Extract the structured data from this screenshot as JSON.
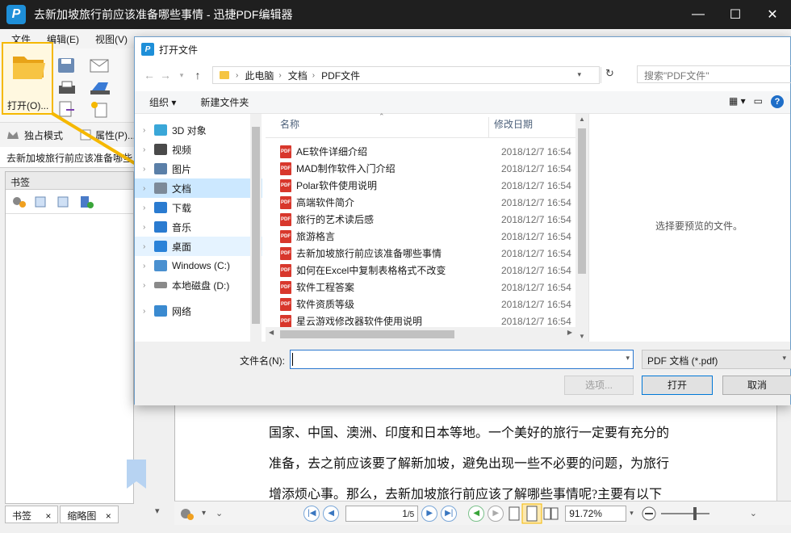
{
  "app": {
    "logo_letter": "P",
    "title": "去新加坡旅行前应该准备哪些事情 - 迅捷PDF编辑器",
    "window_buttons": [
      "—",
      "☐",
      "✕"
    ]
  },
  "menu": [
    "文件",
    "编辑(E)",
    "视图(V)"
  ],
  "ribbon": {
    "open_label": "打开(O)...",
    "exclusive_mode": "独占模式",
    "properties": "属性(P)..."
  },
  "doc_tab": "去新加坡旅行前应该准备哪些",
  "left_panel": {
    "title": "书签",
    "bottom_tabs": [
      {
        "label": "书签",
        "close": "×"
      },
      {
        "label": "缩略图",
        "close": "×"
      }
    ]
  },
  "document": {
    "lines": [
      "国家、中国、澳洲、印度和日本等地。一个美好的旅行一定要有充分的",
      "准备，去之前应该要了解新加坡，避免出现一些不必要的问题，为旅行",
      "增添烦心事。那么，去新加坡旅行前应该了解哪些事情呢?主要有以下"
    ]
  },
  "statusbar": {
    "page": "1",
    "page_total": "/5",
    "zoom": "91.72%"
  },
  "dialog": {
    "title": "打开文件",
    "logo_letter": "P",
    "breadcrumbs": [
      "此电脑",
      "文档",
      "PDF文件"
    ],
    "search_placeholder": "搜索\"PDF文件\"",
    "organize": "组织 ▾",
    "new_folder": "新建文件夹",
    "nav_items": [
      {
        "label": "3D 对象",
        "icon": "cube-3d-icon",
        "color": "#3aa7d8"
      },
      {
        "label": "视频",
        "icon": "video-icon",
        "color": "#4a4a4a"
      },
      {
        "label": "图片",
        "icon": "picture-icon",
        "color": "#5a7fa8"
      },
      {
        "label": "文档",
        "icon": "document-icon",
        "color": "#7d8a99"
      },
      {
        "label": "下载",
        "icon": "download-arrow-icon",
        "color": "#2a7bd0"
      },
      {
        "label": "音乐",
        "icon": "music-note-icon",
        "color": "#2a7bd0"
      },
      {
        "label": "桌面",
        "icon": "desktop-icon",
        "color": "#2a82d8"
      },
      {
        "label": "Windows (C:)",
        "icon": "windows-drive-icon",
        "color": "#4a90d0"
      },
      {
        "label": "本地磁盘 (D:)",
        "icon": "disk-drive-icon",
        "color": "#8a8a8a"
      },
      {
        "label": "网络",
        "icon": "network-icon",
        "color": "#3a8ad0"
      }
    ],
    "columns": {
      "name": "名称",
      "date": "修改日期"
    },
    "files": [
      {
        "name": "AE软件详细介绍",
        "date": "2018/12/7 16:54"
      },
      {
        "name": "MAD制作软件入门介绍",
        "date": "2018/12/7 16:54"
      },
      {
        "name": "Polar软件使用说明",
        "date": "2018/12/7 16:54"
      },
      {
        "name": "高端软件简介",
        "date": "2018/12/7 16:54"
      },
      {
        "name": "旅行的艺术读后感",
        "date": "2018/12/7 16:54"
      },
      {
        "name": "旅游格言",
        "date": "2018/12/7 16:54"
      },
      {
        "name": "去新加坡旅行前应该准备哪些事情",
        "date": "2018/12/7 16:54"
      },
      {
        "name": "如何在Excel中复制表格格式不改变",
        "date": "2018/12/7 16:54"
      },
      {
        "name": "软件工程答案",
        "date": "2018/12/7 16:54"
      },
      {
        "name": "软件资质等级",
        "date": "2018/12/7 16:54"
      },
      {
        "name": "星云游戏修改器软件使用说明",
        "date": "2018/12/7 16:54"
      }
    ],
    "pdf_badge": "PDF",
    "preview_text": "选择要预览的文件。",
    "filename_label": "文件名(N):",
    "filename_value": "",
    "filetype": "PDF 文档 (*.pdf)",
    "buttons": {
      "options": "选项...",
      "open": "打开",
      "cancel": "取消"
    }
  },
  "colors": {
    "highlight": "#f5b800",
    "selection": "#cce8ff",
    "accent": "#0078d7",
    "pdf_icon": "#d8372c"
  }
}
